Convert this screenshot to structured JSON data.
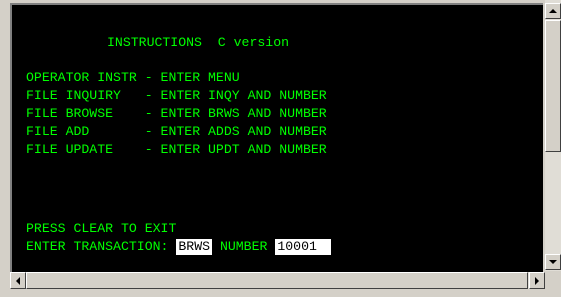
{
  "colors": {
    "screen_background": "#000000",
    "terminal_text": "#00ff00",
    "input_field_background": "#ffffff",
    "input_field_text": "#000000",
    "chrome": "#d4d0c8"
  },
  "terminal": {
    "title": "INSTRUCTIONS  C version",
    "menu_lines": [
      "OPERATOR INSTR - ENTER MENU",
      "FILE INQUIRY   - ENTER INQY AND NUMBER",
      "FILE BROWSE    - ENTER BRWS AND NUMBER",
      "FILE ADD       - ENTER ADDS AND NUMBER",
      "FILE UPDATE    - ENTER UPDT AND NUMBER"
    ],
    "exit_hint": "PRESS CLEAR TO EXIT",
    "transaction_label": "ENTER TRANSACTION: ",
    "transaction_value": "BRWS",
    "number_label": " NUMBER ",
    "number_value": "10001"
  },
  "scrollbars": {
    "up_icon": "arrow-up-icon",
    "down_icon": "arrow-down-icon",
    "left_icon": "arrow-left-icon",
    "right_icon": "arrow-right-icon"
  }
}
